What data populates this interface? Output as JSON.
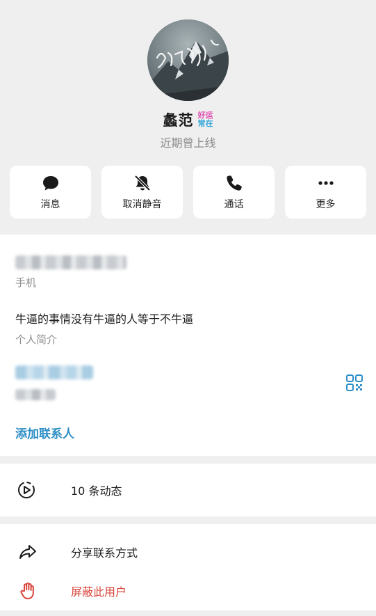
{
  "profile": {
    "name": "蠡范",
    "badge_line1": "好运",
    "badge_line2": "常在",
    "status": "近期曾上线",
    "avatar_icon": "mountain-calligraphy-avatar"
  },
  "actions": [
    {
      "label": "消息",
      "icon": "chat-bubble-icon"
    },
    {
      "label": "取消静音",
      "icon": "bell-muted-icon"
    },
    {
      "label": "通话",
      "icon": "phone-icon"
    },
    {
      "label": "更多",
      "icon": "more-dots-icon"
    }
  ],
  "info": {
    "phone_label": "手机",
    "bio_value": "牛逼的事情没有牛逼的人等于不牛逼",
    "bio_label": "个人简介",
    "add_contact": "添加联系人"
  },
  "moments": {
    "label": "10 条动态"
  },
  "menu": {
    "share": "分享联系方式",
    "block": "屏蔽此用户"
  },
  "colors": {
    "accent": "#2d8ec6",
    "danger": "#d9443a",
    "background": "#efefef"
  }
}
